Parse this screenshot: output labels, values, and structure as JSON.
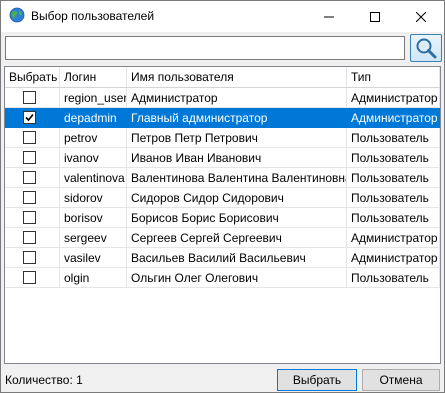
{
  "window": {
    "title": "Выбор пользователей",
    "icon": "globe-icon"
  },
  "search": {
    "value": "",
    "placeholder": "",
    "button_icon": "magnifier-icon"
  },
  "table": {
    "columns": [
      "Выбрать",
      "Логин",
      "Имя пользователя",
      "Тип"
    ],
    "rows": [
      {
        "checked": false,
        "login": "region_user",
        "name": "Администратор",
        "type": "Администратор",
        "selected": false
      },
      {
        "checked": true,
        "login": "depadmin",
        "name": "Главный администратор",
        "type": "Администратор",
        "selected": true
      },
      {
        "checked": false,
        "login": "petrov",
        "name": "Петров Петр Петрович",
        "type": "Пользователь",
        "selected": false
      },
      {
        "checked": false,
        "login": "ivanov",
        "name": "Иванов Иван Иванович",
        "type": "Пользователь",
        "selected": false
      },
      {
        "checked": false,
        "login": "valentinova",
        "name": "Валентинова Валентина Валентиновна",
        "type": "Пользователь",
        "selected": false
      },
      {
        "checked": false,
        "login": "sidorov",
        "name": "Сидоров Сидор Сидорович",
        "type": "Пользователь",
        "selected": false
      },
      {
        "checked": false,
        "login": "borisov",
        "name": "Борисов Борис Борисович",
        "type": "Пользователь",
        "selected": false
      },
      {
        "checked": false,
        "login": "sergeev",
        "name": "Сергеев Сергей Сергеевич",
        "type": "Администратор",
        "selected": false
      },
      {
        "checked": false,
        "login": "vasilev",
        "name": "Васильев Василий Васильевич",
        "type": "Администратор",
        "selected": false
      },
      {
        "checked": false,
        "login": "olgin",
        "name": "Ольгин Олег Олегович",
        "type": "Пользователь",
        "selected": false
      }
    ]
  },
  "footer": {
    "count_text": "Количество: 1",
    "select_label": "Выбрать",
    "cancel_label": "Отмена"
  },
  "colors": {
    "selection": "#0078d7"
  }
}
